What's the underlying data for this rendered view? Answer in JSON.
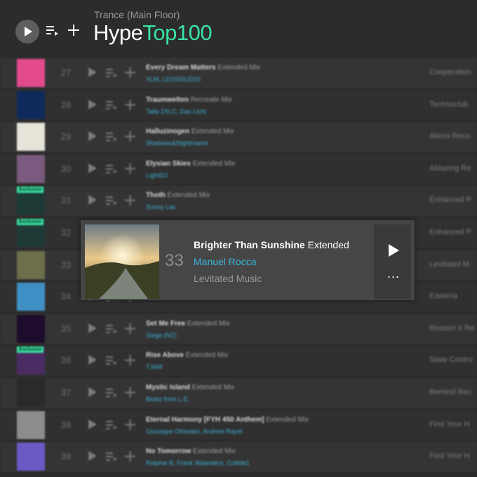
{
  "header": {
    "play_icon": "play-icon",
    "queue_icon": "add-to-queue-icon",
    "plus_icon": "plus-icon",
    "subtitle": "Trance (Main Floor)",
    "title_part1": "Hype",
    "title_part2": "Top100"
  },
  "colors": {
    "accent": "#39e3a3",
    "artist": "#3aaed0"
  },
  "rows": [
    {
      "num": "27",
      "title": "Every Dream Matters",
      "mix": "Extended Mix",
      "artists": "XLM, LESSISLESS",
      "label": "Cooperation",
      "tag": ""
    },
    {
      "num": "28",
      "title": "Traumwelten",
      "mix": "Recreate Mix",
      "artists": "Talla 2XLC, Das Licht",
      "label": "Technoclub",
      "tag": ""
    },
    {
      "num": "29",
      "title": "Halluzinogen",
      "mix": "Extended Mix",
      "artists": "Shadows&Nightmares",
      "label": "Abora Reco",
      "tag": ""
    },
    {
      "num": "30",
      "title": "Elysian Skies",
      "mix": "Extended Mix",
      "artists": "LightDJ",
      "label": "Ablazing Re",
      "tag": ""
    },
    {
      "num": "31",
      "title": "Thoth",
      "mix": "Extended Mix",
      "artists": "Sunny Lax",
      "label": "Enhanced P",
      "tag": "Exclusive"
    },
    {
      "num": "32",
      "title": "",
      "mix": "",
      "artists": "",
      "label": "Enhanced P",
      "tag": "Exclusive"
    },
    {
      "num": "33",
      "title": "",
      "mix": "",
      "artists": "",
      "label": "Levitated M",
      "tag": ""
    },
    {
      "num": "34",
      "title": "",
      "mix": "",
      "artists": "",
      "label": "Easteria",
      "tag": ""
    },
    {
      "num": "35",
      "title": "Set Me Free",
      "mix": "Extended Mix",
      "artists": "Siege (NZ)",
      "label": "Reason II Re",
      "tag": ""
    },
    {
      "num": "36",
      "title": "Rise Above",
      "mix": "Extended Mix",
      "artists": "TJAM",
      "label": "State Contro",
      "tag": "Exclusive"
    },
    {
      "num": "37",
      "title": "Mystic Island",
      "mix": "Extended Mix",
      "artists": "Beatz from L.E.",
      "label": "Bemind Rec",
      "tag": ""
    },
    {
      "num": "38",
      "title": "Eternal Harmony [FYH 450 Anthem]",
      "mix": "Extended Mix",
      "artists": "Giuseppe Ottaviani, Andrew Rayel",
      "label": "Find Your H",
      "tag": ""
    },
    {
      "num": "39",
      "title": "No Tomorrow",
      "mix": "Extended Mix",
      "artists": "Ralphie B, Frank Waanders, Collide1",
      "label": "Find Your H",
      "tag": ""
    }
  ],
  "popup": {
    "num": "33",
    "track_title": "Brighter Than Sunshine",
    "track_mix": "Extended",
    "artist": "Manuel Rocca",
    "label": "Levitated Music",
    "play_icon": "play-icon",
    "more_icon": "more-icon",
    "more_label": "..."
  }
}
